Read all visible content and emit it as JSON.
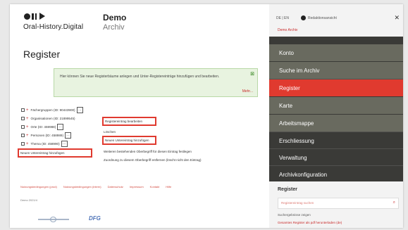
{
  "header": {
    "logo_text": "Oral-History.Digital",
    "project_title": "Demo",
    "project_subtitle": "Archiv"
  },
  "page": {
    "title": "Register"
  },
  "notice": {
    "text": "Hier können Sie neue Registerbäume anlegen und Unter-Registereinträge hinzufügen und bearbeiten.",
    "more": "Mehr...",
    "close_icon": "close-icon"
  },
  "tree": [
    {
      "label": "Fächergruppen (ID: 90443900)"
    },
    {
      "label": "Organisationen (ID: 21899545)"
    },
    {
      "label": "Orte (ID: 459988)"
    },
    {
      "label": "Personen (ID: 458989)"
    },
    {
      "label": "Thema (ID: 458990)"
    }
  ],
  "tree_menu_symbol": "…",
  "context_menu": {
    "edit": "Registereintrag bearbeiten",
    "delete": "Löschen",
    "add_child": "Neuen Untereintrag hinzufügen",
    "assign_parent": "Weiteren bestehenden Oberbegriff für diesen Eintrag festlegen",
    "remove_parent": "Zuordnung zu diesem Oberbegriff entfernen (löscht nicht den Eintrag)"
  },
  "add_subentry_button": "Neuen Untereintrag hinzufügen",
  "footer": {
    "links": [
      "Nutzungsbedingungen (prod)",
      "Nutzungsbedingungen (intern)",
      "Datenschutz",
      "Impressum",
      "Kontakt",
      "Hilfe"
    ],
    "sub": "Demo 2021/4",
    "logo2": "DFG"
  },
  "sidebar": {
    "lang": "DE | EN",
    "mode": "Redaktionsansicht",
    "archive": "Demo Archiv",
    "close_icon": "close-icon",
    "items": [
      {
        "label": "Konto"
      },
      {
        "label": "Suche im Archiv"
      },
      {
        "label": "Register"
      },
      {
        "label": "Karte"
      },
      {
        "label": "Arbeitsmappe"
      },
      {
        "label": "Erschliessung"
      },
      {
        "label": "Verwaltung"
      },
      {
        "label": "Archivkonfiguration"
      }
    ],
    "panel": {
      "title": "Register",
      "search_placeholder": "Registereintrag suchen",
      "show_tree": "Suchergebnisse zeigen",
      "export": "Gesamtes Register als pdf herunterladen (de)"
    }
  },
  "colors": {
    "accent": "#e03a2f",
    "sidebar_dark": "#3a3a37",
    "sidebar_olive": "#696a5f",
    "notice_bg": "#e8f3e0"
  }
}
